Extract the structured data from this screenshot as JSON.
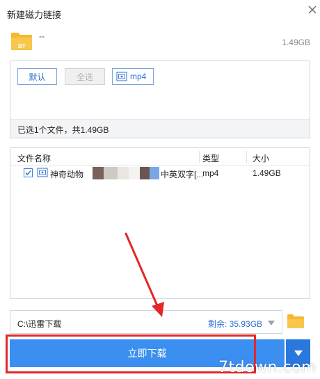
{
  "window": {
    "title": "新建磁力链接",
    "close_icon": "close-icon"
  },
  "file": {
    "icon": "bt-folder-icon",
    "icon_label": "BT",
    "name": "--",
    "size": "1.49GB"
  },
  "filters": {
    "default_label": "默认",
    "select_all_label": "全选",
    "mp4_label": "mp4",
    "summary": "已选1个文件，共1.49GB"
  },
  "table": {
    "headers": {
      "name": "文件名称",
      "type": "类型",
      "size": "大小"
    },
    "rows": [
      {
        "checked": true,
        "name_prefix": "神奇动物",
        "name_suffix": "中英双字[...",
        "type": "mp4",
        "size": "1.49GB"
      }
    ]
  },
  "save": {
    "path": "C:\\迅雷下载",
    "free_space": "剩余: 35.93GB",
    "folder_icon": "folder-icon"
  },
  "download": {
    "button_label": "立即下载",
    "dropdown_icon": "chevron-down-icon"
  },
  "watermark": "7tdown.com",
  "colors": {
    "accent": "#3b8ff0",
    "link_blue": "#2f6fd1",
    "annotation_red": "#e02828",
    "folder_yellow": "#f5b82e"
  }
}
